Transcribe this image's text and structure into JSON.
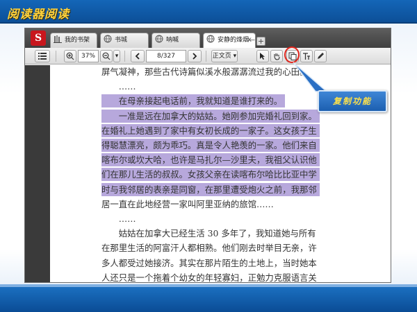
{
  "slide": {
    "title": "阅读器阅读"
  },
  "colors": {
    "header_blue": "#1466b8",
    "title_yellow": "#ffd23c",
    "highlight_purple": "#b7a8dc",
    "callout_blue": "#2a6fc4",
    "circle_red": "#e0241b"
  },
  "tabs": [
    {
      "label": "我的书架",
      "icon": "bookshelf-icon",
      "active": false
    },
    {
      "label": "书城",
      "icon": "globe-icon",
      "active": false
    },
    {
      "label": "呐喊",
      "icon": "globe-icon",
      "active": false
    },
    {
      "label": "安静的烽烟—...",
      "icon": "globe-icon",
      "active": true,
      "close": "x"
    }
  ],
  "newtab_label": "+",
  "toolbar": {
    "list_icon": "list-icon",
    "zoom_in_icon": "zoom-in-icon",
    "zoom_value": "37%",
    "zoom_out_icon": "zoom-out-icon",
    "dropdown_arrow": "▾",
    "prev_icon": "chevron-left-icon",
    "page_value": "8/327",
    "next_icon": "chevron-right-icon",
    "view_mode": "正文页",
    "select_icon": "cursor-arrow-icon",
    "hand_icon": "hand-icon",
    "copy_icon": "copy-icon",
    "text_icon": "text-tool-icon",
    "pen_icon": "pen-icon"
  },
  "content": {
    "lines": [
      {
        "text": "屏气凝神，那些古代诗篇似溪水般潺潺流过我的心田。",
        "highlight": false
      },
      {
        "text": "　　……",
        "highlight": false
      },
      {
        "text": "　　在母亲接起电话前，我就知道是谁打来的。",
        "highlight": true
      },
      {
        "text": "　　一准是远在加拿大的姑姑。她刚参加完婚礼回到家。",
        "highlight": true
      },
      {
        "text": "在婚礼上她遇到了家中有女初长成的一家子。这女孩子生",
        "highlight": true
      },
      {
        "text": "得聪慧漂亮，颇为乖巧。真是令人艳羡的一家。他们来自",
        "highlight": true
      },
      {
        "text": "喀布尔或坎大哈，也许是马扎尔—沙里夫，我祖父认识他",
        "highlight": true
      },
      {
        "text": "们在那儿生活的叔叔。女孩父亲在读喀布尔哈比比亚中学",
        "highlight": true
      },
      {
        "text": "时与我邻居的表亲是同窗，在那里遭受炮火之前，我那邻",
        "highlight": true
      },
      {
        "text": "居一直在此地经营一家叫阿里亚纳的旅馆……",
        "highlight": false
      },
      {
        "text": "　　……",
        "highlight": false
      },
      {
        "text": "　　姑姑在加拿大已经生活 30 多年了，我知道她与所有",
        "highlight": false
      },
      {
        "text": "在那里生活的阿富汗人都相熟。他们刚去时举目无亲，许",
        "highlight": false
      },
      {
        "text": "多人都受过她接济。其实在那片陌生的土地上，当时她本",
        "highlight": false
      },
      {
        "text": "人还只是一个拖着个幼女的年轻寡妇，正勉力克服语言关",
        "highlight": false
      }
    ]
  },
  "callout": {
    "text": "复制功能"
  }
}
